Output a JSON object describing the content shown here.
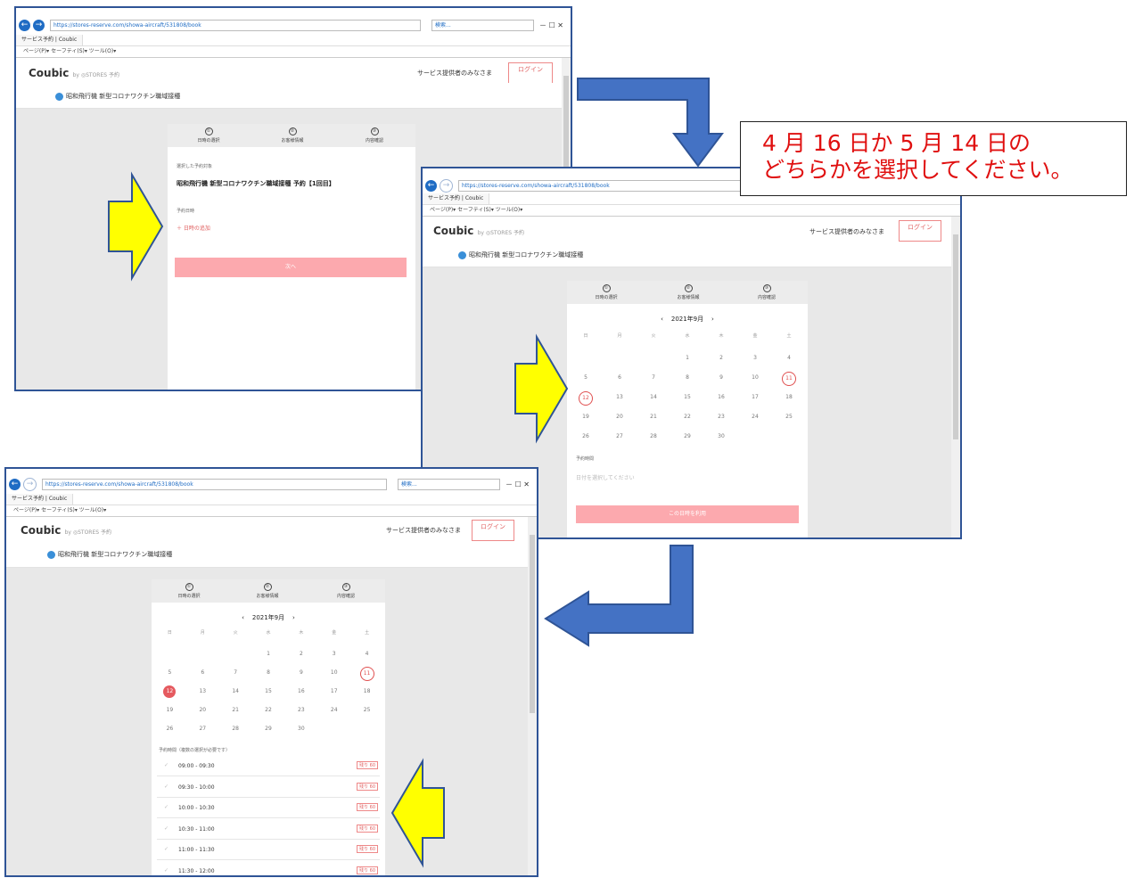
{
  "browser": {
    "url1": "https://stores-reserve.com/showa-aircraft/531808/book",
    "url2": "https://stores-reserve.com/showa-aircraft/531808/book",
    "url3": "https://stores-reserve.com/showa-aircraft/531808/book",
    "search_placeholder": "検索...",
    "tab_title": "サービス予約 | Coubic",
    "toolbar": "ページ(P)▾  セーフティ(S)▾  ツール(O)▾"
  },
  "site": {
    "logo": "Coubic",
    "logo_by": "by ◎STORES 予約",
    "provider_link": "サービス提供者のみなさま",
    "login": "ログイン",
    "shop_name": "昭和飛行機 新型コロナワクチン職域接種"
  },
  "steps": [
    "日時の選択",
    "お客様情報",
    "内容確認"
  ],
  "step_nums": [
    "①",
    "②",
    "③"
  ],
  "screen1": {
    "selected_label": "選択した予約対象",
    "selected_value": "昭和飛行機 新型コロナワクチン職域接種 予約【1回目】",
    "date_label": "予約日時",
    "add_date": "＋ 日時の追加",
    "next_button": "次へ"
  },
  "calendar": {
    "prev": "‹",
    "next": "›",
    "month": "2021年9月",
    "weekdays": [
      "日",
      "月",
      "火",
      "水",
      "木",
      "金",
      "土"
    ],
    "weeks": [
      [
        "",
        "",
        "",
        "1",
        "2",
        "3",
        "4"
      ],
      [
        "5",
        "6",
        "7",
        "8",
        "9",
        "10",
        "11"
      ],
      [
        "12",
        "13",
        "14",
        "15",
        "16",
        "17",
        "18"
      ],
      [
        "19",
        "20",
        "21",
        "22",
        "23",
        "24",
        "25"
      ],
      [
        "26",
        "27",
        "28",
        "29",
        "30",
        "",
        ""
      ]
    ]
  },
  "screen2": {
    "time_label": "予約時間",
    "time_placeholder": "日付を選択してください",
    "use_date_button": "この日時を利用"
  },
  "screen3": {
    "time_label": "予約時間（複数の選択が必要です）",
    "slots": [
      {
        "time": "09:00 - 09:30",
        "badge": "残り 60"
      },
      {
        "time": "09:30 - 10:00",
        "badge": "残り 60"
      },
      {
        "time": "10:00 - 10:30",
        "badge": "残り 60"
      },
      {
        "time": "10:30 - 11:00",
        "badge": "残り 60"
      },
      {
        "time": "11:00 - 11:30",
        "badge": "残り 60"
      },
      {
        "time": "11:30 - 12:00",
        "badge": "残り 60"
      }
    ]
  },
  "callout": {
    "line1": "4 月 16 日か 5 月 14 日の",
    "line2": "どちらかを選択してください。"
  },
  "colors": {
    "frame": "#2f5496",
    "arrow_blue": "#4472c4",
    "arrow_yellow": "#ffff00",
    "accent": "#e55a5f",
    "button": "#fca9ae"
  }
}
